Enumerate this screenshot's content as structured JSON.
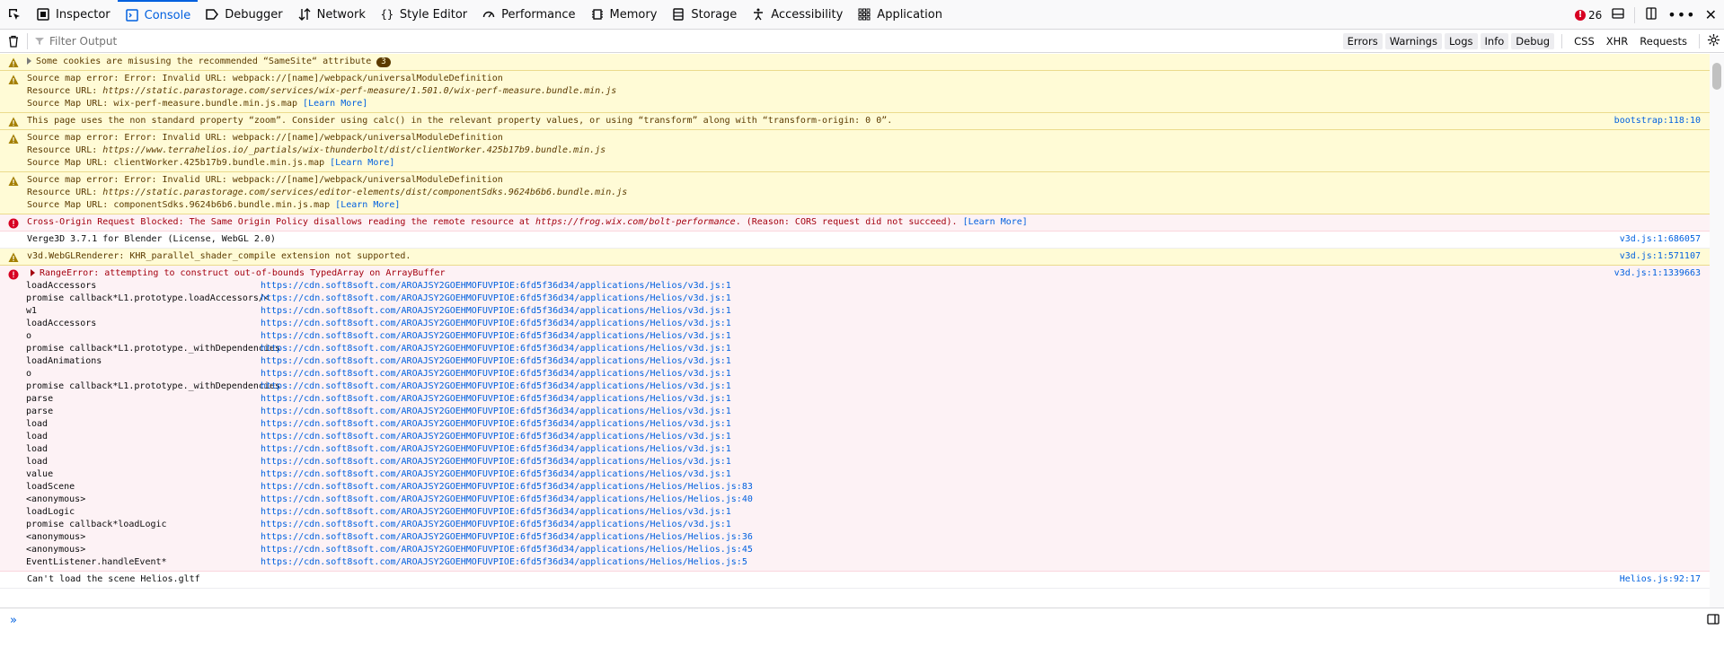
{
  "toolbar": {
    "tabs": [
      {
        "label": "Inspector",
        "icon": "inspector-icon"
      },
      {
        "label": "Console",
        "icon": "console-icon"
      },
      {
        "label": "Debugger",
        "icon": "debugger-icon"
      },
      {
        "label": "Network",
        "icon": "network-icon"
      },
      {
        "label": "Style Editor",
        "icon": "style-editor-icon"
      },
      {
        "label": "Performance",
        "icon": "performance-icon"
      },
      {
        "label": "Memory",
        "icon": "memory-icon"
      },
      {
        "label": "Storage",
        "icon": "storage-icon"
      },
      {
        "label": "Accessibility",
        "icon": "accessibility-icon"
      },
      {
        "label": "Application",
        "icon": "application-icon"
      }
    ],
    "active_tab": "Console",
    "error_count": "26"
  },
  "filter": {
    "placeholder": "Filter Output",
    "buttons": [
      "Errors",
      "Warnings",
      "Logs",
      "Info",
      "Debug"
    ],
    "extra": [
      "CSS",
      "XHR",
      "Requests"
    ]
  },
  "messages": {
    "m1": {
      "text": "Some cookies are misusing the recommended “SameSite“ attribute",
      "badge": "3"
    },
    "m2": {
      "l1": "Source map error: Error: Invalid URL: webpack://[name]/webpack/universalModuleDefinition",
      "l2_prefix": "Resource URL: ",
      "l2_url": "https://static.parastorage.com/services/wix-perf-measure/1.501.0/wix-perf-measure.bundle.min.js",
      "l3_prefix": "Source Map URL: wix-perf-measure.bundle.min.js.map ",
      "learn": "[Learn More]"
    },
    "m3": {
      "text": "This page uses the non standard property “zoom”. Consider using calc() in the relevant property values, or using “transform” along with “transform-origin: 0 0”.",
      "loc": "bootstrap:118:10"
    },
    "m4": {
      "l1": "Source map error: Error: Invalid URL: webpack://[name]/webpack/universalModuleDefinition",
      "l2_prefix": "Resource URL: ",
      "l2_url": "https://www.terrahelios.io/_partials/wix-thunderbolt/dist/clientWorker.425b17b9.bundle.min.js",
      "l3_prefix": "Source Map URL: clientWorker.425b17b9.bundle.min.js.map ",
      "learn": "[Learn More]"
    },
    "m5": {
      "l1": "Source map error: Error: Invalid URL: webpack://[name]/webpack/universalModuleDefinition",
      "l2_prefix": "Resource URL: ",
      "l2_url": "https://static.parastorage.com/services/editor-elements/dist/componentSdks.9624b6b6.bundle.min.js",
      "l3_prefix": "Source Map URL: componentSdks.9624b6b6.bundle.min.js.map ",
      "learn": "[Learn More]"
    },
    "m6": {
      "prefix": "Cross-Origin Request Blocked: The Same Origin Policy disallows reading the remote resource at ",
      "url": "https://frog.wix.com/bolt-performance",
      "suffix": ". (Reason: CORS request did not succeed). ",
      "learn": "[Learn More]"
    },
    "m7": {
      "text": "Verge3D 3.7.1 for Blender (License, WebGL 2.0)",
      "loc": "v3d.js:1:686057"
    },
    "m8": {
      "text": "v3d.WebGLRenderer: KHR_parallel_shader_compile extension not supported.",
      "loc": "v3d.js:1:571107"
    },
    "m9": {
      "text": "RangeError: attempting to construct out-of-bounds TypedArray on ArrayBuffer",
      "loc": "v3d.js:1:1339663"
    },
    "m10": {
      "text": "Can't load the scene Helios.gltf",
      "loc": "Helios.js:92:17"
    }
  },
  "stack": [
    {
      "fn": "loadAccessors",
      "loc": "https://cdn.soft8soft.com/AROAJSY2GOEHMOFUVPIOE:6fd5f36d34/applications/Helios/v3d.js:1"
    },
    {
      "fn": "promise callback*L1.prototype.loadAccessors/<",
      "loc": "https://cdn.soft8soft.com/AROAJSY2GOEHMOFUVPIOE:6fd5f36d34/applications/Helios/v3d.js:1"
    },
    {
      "fn": "w1",
      "loc": "https://cdn.soft8soft.com/AROAJSY2GOEHMOFUVPIOE:6fd5f36d34/applications/Helios/v3d.js:1"
    },
    {
      "fn": "loadAccessors",
      "loc": "https://cdn.soft8soft.com/AROAJSY2GOEHMOFUVPIOE:6fd5f36d34/applications/Helios/v3d.js:1"
    },
    {
      "fn": "o",
      "loc": "https://cdn.soft8soft.com/AROAJSY2GOEHMOFUVPIOE:6fd5f36d34/applications/Helios/v3d.js:1"
    },
    {
      "fn": "promise callback*L1.prototype._withDependencies",
      "loc": "https://cdn.soft8soft.com/AROAJSY2GOEHMOFUVPIOE:6fd5f36d34/applications/Helios/v3d.js:1"
    },
    {
      "fn": "loadAnimations",
      "loc": "https://cdn.soft8soft.com/AROAJSY2GOEHMOFUVPIOE:6fd5f36d34/applications/Helios/v3d.js:1"
    },
    {
      "fn": "o",
      "loc": "https://cdn.soft8soft.com/AROAJSY2GOEHMOFUVPIOE:6fd5f36d34/applications/Helios/v3d.js:1"
    },
    {
      "fn": "promise callback*L1.prototype._withDependencies",
      "loc": "https://cdn.soft8soft.com/AROAJSY2GOEHMOFUVPIOE:6fd5f36d34/applications/Helios/v3d.js:1"
    },
    {
      "fn": "parse",
      "loc": "https://cdn.soft8soft.com/AROAJSY2GOEHMOFUVPIOE:6fd5f36d34/applications/Helios/v3d.js:1"
    },
    {
      "fn": "parse",
      "loc": "https://cdn.soft8soft.com/AROAJSY2GOEHMOFUVPIOE:6fd5f36d34/applications/Helios/v3d.js:1"
    },
    {
      "fn": "load",
      "loc": "https://cdn.soft8soft.com/AROAJSY2GOEHMOFUVPIOE:6fd5f36d34/applications/Helios/v3d.js:1"
    },
    {
      "fn": "load",
      "loc": "https://cdn.soft8soft.com/AROAJSY2GOEHMOFUVPIOE:6fd5f36d34/applications/Helios/v3d.js:1"
    },
    {
      "fn": "load",
      "loc": "https://cdn.soft8soft.com/AROAJSY2GOEHMOFUVPIOE:6fd5f36d34/applications/Helios/v3d.js:1"
    },
    {
      "fn": "load",
      "loc": "https://cdn.soft8soft.com/AROAJSY2GOEHMOFUVPIOE:6fd5f36d34/applications/Helios/v3d.js:1"
    },
    {
      "fn": "value",
      "loc": "https://cdn.soft8soft.com/AROAJSY2GOEHMOFUVPIOE:6fd5f36d34/applications/Helios/v3d.js:1"
    },
    {
      "fn": "loadScene",
      "loc": "https://cdn.soft8soft.com/AROAJSY2GOEHMOFUVPIOE:6fd5f36d34/applications/Helios/Helios.js:83"
    },
    {
      "fn": "<anonymous>",
      "loc": "https://cdn.soft8soft.com/AROAJSY2GOEHMOFUVPIOE:6fd5f36d34/applications/Helios/Helios.js:40"
    },
    {
      "fn": "loadLogic",
      "loc": "https://cdn.soft8soft.com/AROAJSY2GOEHMOFUVPIOE:6fd5f36d34/applications/Helios/v3d.js:1"
    },
    {
      "fn": "promise callback*loadLogic",
      "loc": "https://cdn.soft8soft.com/AROAJSY2GOEHMOFUVPIOE:6fd5f36d34/applications/Helios/v3d.js:1"
    },
    {
      "fn": "<anonymous>",
      "loc": "https://cdn.soft8soft.com/AROAJSY2GOEHMOFUVPIOE:6fd5f36d34/applications/Helios/Helios.js:36"
    },
    {
      "fn": "<anonymous>",
      "loc": "https://cdn.soft8soft.com/AROAJSY2GOEHMOFUVPIOE:6fd5f36d34/applications/Helios/Helios.js:45"
    },
    {
      "fn": "EventListener.handleEvent*",
      "loc": "https://cdn.soft8soft.com/AROAJSY2GOEHMOFUVPIOE:6fd5f36d34/applications/Helios/Helios.js:5"
    }
  ],
  "colors": {
    "accent": "#0060df",
    "warning_bg": "#fffbd6",
    "error_bg": "#fdf2f5",
    "error_text": "#a4000f",
    "warning_text": "#5c3b00"
  }
}
